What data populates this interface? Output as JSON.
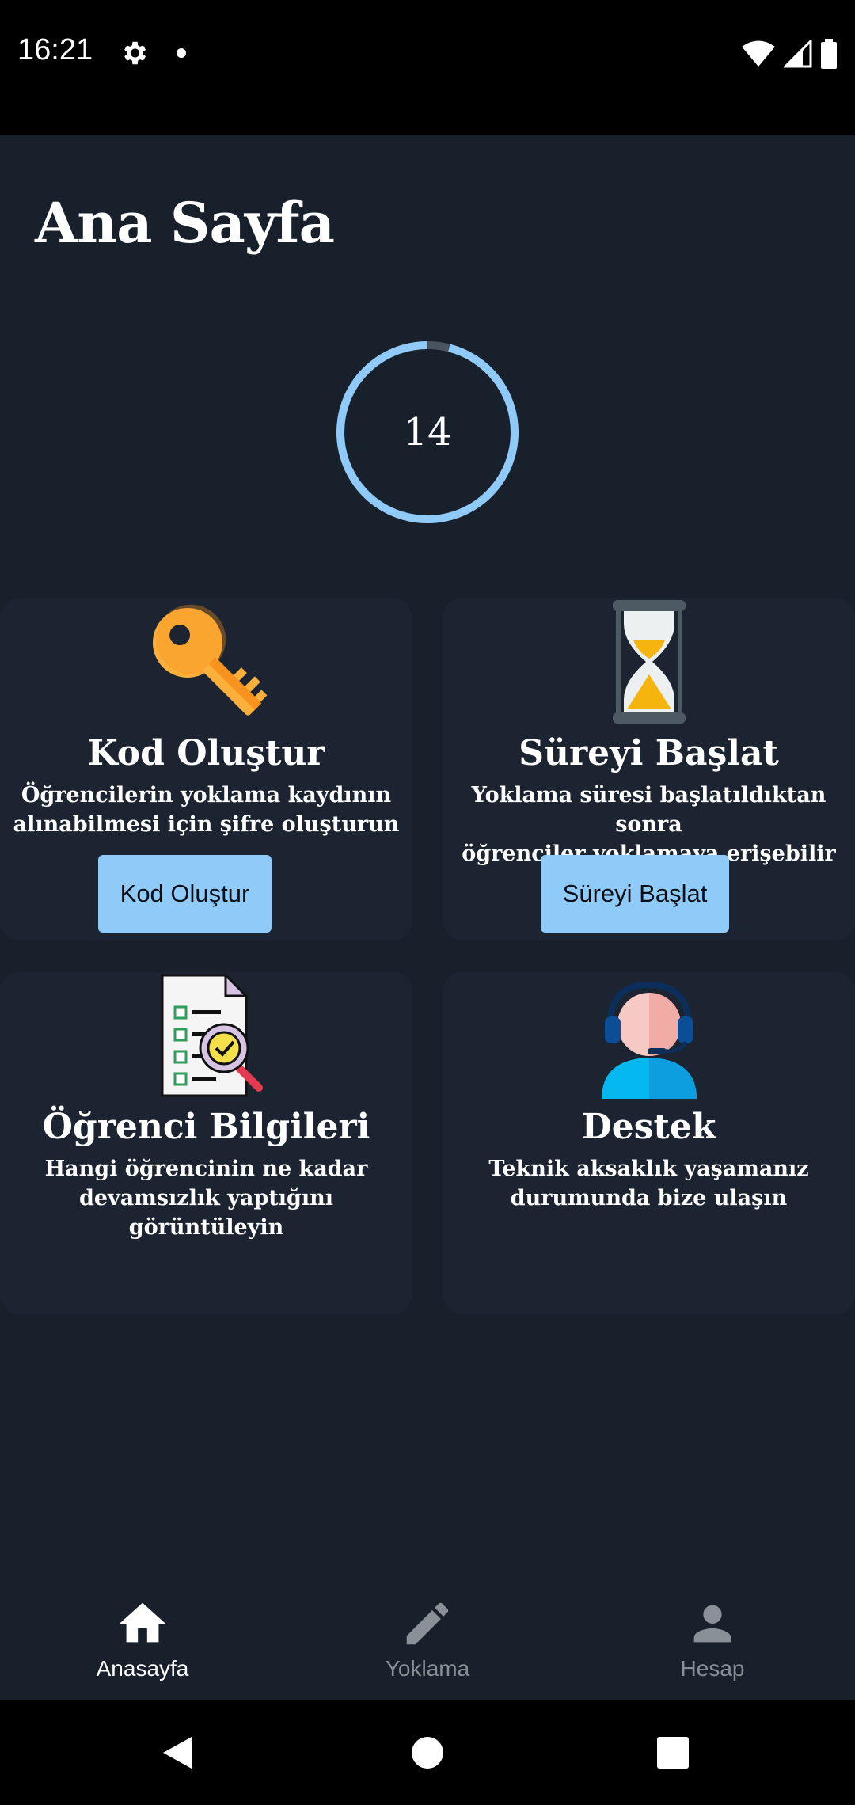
{
  "status": {
    "time": "16:21"
  },
  "header": {
    "title": "Ana Sayfa"
  },
  "timer": {
    "value": "14",
    "progress": 0.96
  },
  "cards": [
    {
      "title": "Kod Oluştur",
      "desc1": "Öğrencilerin yoklama kaydının",
      "desc2": "alınabilmesi için şifre oluşturun",
      "button": "Kod Oluştur"
    },
    {
      "title": "Süreyi Başlat",
      "desc1": "Yoklama süresi başlatıldıktan sonra",
      "desc2": "öğrenciler yoklamaya erişebilir",
      "button": "Süreyi Başlat"
    },
    {
      "title": "Öğrenci Bilgileri",
      "desc1": "Hangi öğrencinin ne kadar",
      "desc2": "devamsızlık yaptığını görüntüleyin"
    },
    {
      "title": "Destek",
      "desc1": "Teknik aksaklık yaşamanız",
      "desc2": "durumunda bize ulaşın"
    }
  ],
  "nav": [
    {
      "label": "Anasayfa",
      "icon": "home-icon",
      "active": true
    },
    {
      "label": "Yoklama",
      "icon": "pencil-icon",
      "active": false
    },
    {
      "label": "Hesap",
      "icon": "person-icon",
      "active": false
    }
  ],
  "colors": {
    "background": "#18202b",
    "card": "#1b2430",
    "accent": "#90caf9"
  }
}
